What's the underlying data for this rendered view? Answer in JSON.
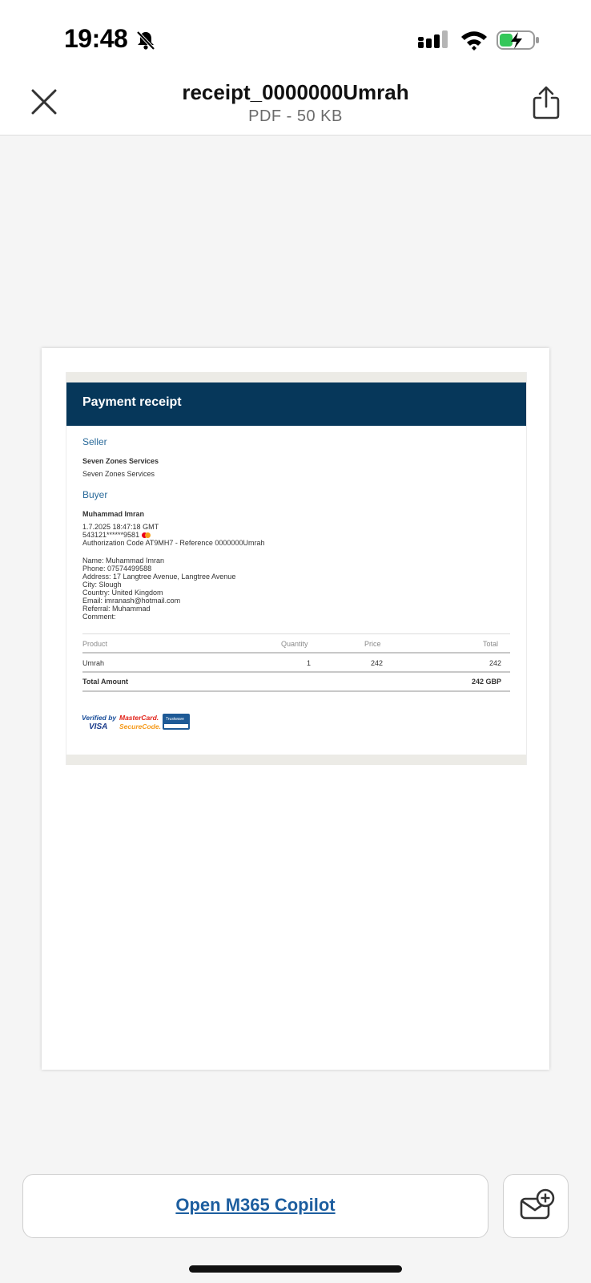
{
  "status_bar": {
    "time": "19:48"
  },
  "header": {
    "title": "receipt_0000000Umrah",
    "subtitle": "PDF - 50 KB"
  },
  "receipt": {
    "heading": "Payment receipt",
    "seller_label": "Seller",
    "seller_name_bold": "Seven Zones Services",
    "seller_name": "Seven Zones Services",
    "buyer_label": "Buyer",
    "buyer_name_bold": "Muhammad Imran",
    "date": "1.7.2025 18:47:18 GMT",
    "card": "543121******9581",
    "auth": "Authorization Code AT9MH7 - Reference 0000000Umrah",
    "details": [
      "Name: Muhammad Imran",
      "Phone: 07574499588",
      "Address: 17 Langtree Avenue, Langtree Avenue",
      "City: Slough",
      "Country: United Kingdom",
      "Email: imranash@hotmail.com",
      "Referral: Muhammad",
      "Comment:"
    ],
    "table": {
      "headers": [
        "Product",
        "Quantity",
        "Price",
        "Total"
      ],
      "rows": [
        [
          "Umrah",
          "1",
          "242",
          "242"
        ]
      ],
      "total_label": "Total Amount",
      "total_value": "242 GBP"
    },
    "logos": {
      "visa_top": "Verified by",
      "visa_bottom": "VISA",
      "mc_top": "MasterCard.",
      "mc_bottom": "SecureCode.",
      "trustwave": "Trustwave"
    }
  },
  "bottom": {
    "copilot_label": "Open M365 Copilot"
  },
  "colors": {
    "receipt_header": "#06375a",
    "section_label": "#2a6a9a",
    "link": "#1d5e9f",
    "battery_charge": "#34c759"
  }
}
